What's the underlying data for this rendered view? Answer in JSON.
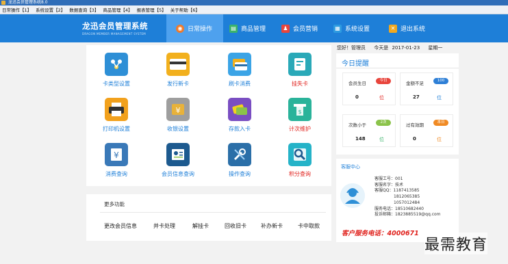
{
  "window": {
    "title": "龙迅会员管理系统8.0"
  },
  "menu": [
    "日常操作【1】",
    "系统设置【2】",
    "数据查询【3】",
    "商品管理【4】",
    "报表管理【5】",
    "关于帮助【6】"
  ],
  "brand": {
    "title": "龙迅会员管理系统",
    "subtitle": "DRAGON MEMBER MANAGEMENT SYSTEM"
  },
  "nav": [
    {
      "label": "日常操作",
      "icon": "daily-operation-icon",
      "color": "#f07a2a"
    },
    {
      "label": "商品管理",
      "icon": "goods-icon",
      "color": "#3bb36b"
    },
    {
      "label": "会员营销",
      "icon": "marketing-icon",
      "color": "#e8453c"
    },
    {
      "label": "系统设置",
      "icon": "settings-icon",
      "color": "#2e9be0"
    },
    {
      "label": "退出系统",
      "icon": "exit-icon",
      "color": "#f0a81f"
    }
  ],
  "functions": [
    {
      "label": "卡类型设置",
      "icon": "card-type-icon",
      "color": "#2e8fd6",
      "label_color": "#1e7fd8"
    },
    {
      "label": "发行新卡",
      "icon": "new-card-icon",
      "color": "#f2b01d",
      "label_color": "#1e7fd8"
    },
    {
      "label": "刷卡消费",
      "icon": "swipe-card-icon",
      "color": "#3ba4e6",
      "label_color": "#1e7fd8"
    },
    {
      "label": "挂失卡",
      "icon": "lost-card-icon",
      "color": "#2aa9b8",
      "label_color": "#e0201b"
    },
    {
      "label": "打印机设置",
      "icon": "printer-icon",
      "color": "#f2a11d",
      "label_color": "#1e7fd8"
    },
    {
      "label": "收银设置",
      "icon": "cashier-icon",
      "color": "#e8b23a",
      "label_color": "#1e7fd8"
    },
    {
      "label": "存款入卡",
      "icon": "deposit-icon",
      "color": "#7a4ec2",
      "label_color": "#1e7fd8"
    },
    {
      "label": "计次维护",
      "icon": "count-maintain-icon",
      "color": "#2ab39a",
      "label_color": "#e0201b"
    },
    {
      "label": "消费查询",
      "icon": "consume-query-icon",
      "color": "#3a79b8",
      "label_color": "#1e7fd8"
    },
    {
      "label": "会员信息查询",
      "icon": "member-info-icon",
      "color": "#1d5a8f",
      "label_color": "#1e7fd8"
    },
    {
      "label": "操作查询",
      "icon": "operation-query-icon",
      "color": "#2b6fa8",
      "label_color": "#1e7fd8"
    },
    {
      "label": "积分查询",
      "icon": "points-query-icon",
      "color": "#25b3c8",
      "label_color": "#e0201b"
    }
  ],
  "more": {
    "title": "更多功能",
    "links": [
      "更改会员信息",
      "并卡处理",
      "解挂卡",
      "回收旧卡",
      "补办新卡",
      "卡中取款"
    ]
  },
  "status": {
    "greeting": "您好！管理员",
    "date_label": "今天是",
    "date": "2017-01-23",
    "weekday": "星期一"
  },
  "today": {
    "title": "今日提醒",
    "items": [
      {
        "label": "会员生日",
        "badge": "今日",
        "badge_color": "#e8453c",
        "count": "0",
        "unit": "位",
        "unit_color": "#e0201b"
      },
      {
        "label": "金额不足",
        "badge": "100",
        "badge_color": "#2e7fd6",
        "count": "27",
        "unit": "位",
        "unit_color": "#1e7fd8"
      },
      {
        "label": "次数小于",
        "badge": "2次",
        "badge_color": "#8bc34a",
        "count": "148",
        "unit": "位",
        "unit_color": "#3bb36b"
      },
      {
        "label": "过有效期",
        "badge": "本日",
        "badge_color": "#f08a24",
        "count": "0",
        "unit": "位",
        "unit_color": "#f08a24"
      }
    ]
  },
  "service": {
    "title": "客服中心",
    "lines": [
      "客服工号：001",
      "客服名字：技术",
      "客服QQ：1187413585",
      "1812065385",
      "1057012484",
      "服务电话：18510682440",
      "投诉邮箱：1823885519@qq.com"
    ],
    "phone": "客户服务电话：4000671"
  },
  "watermark": "最需教育"
}
